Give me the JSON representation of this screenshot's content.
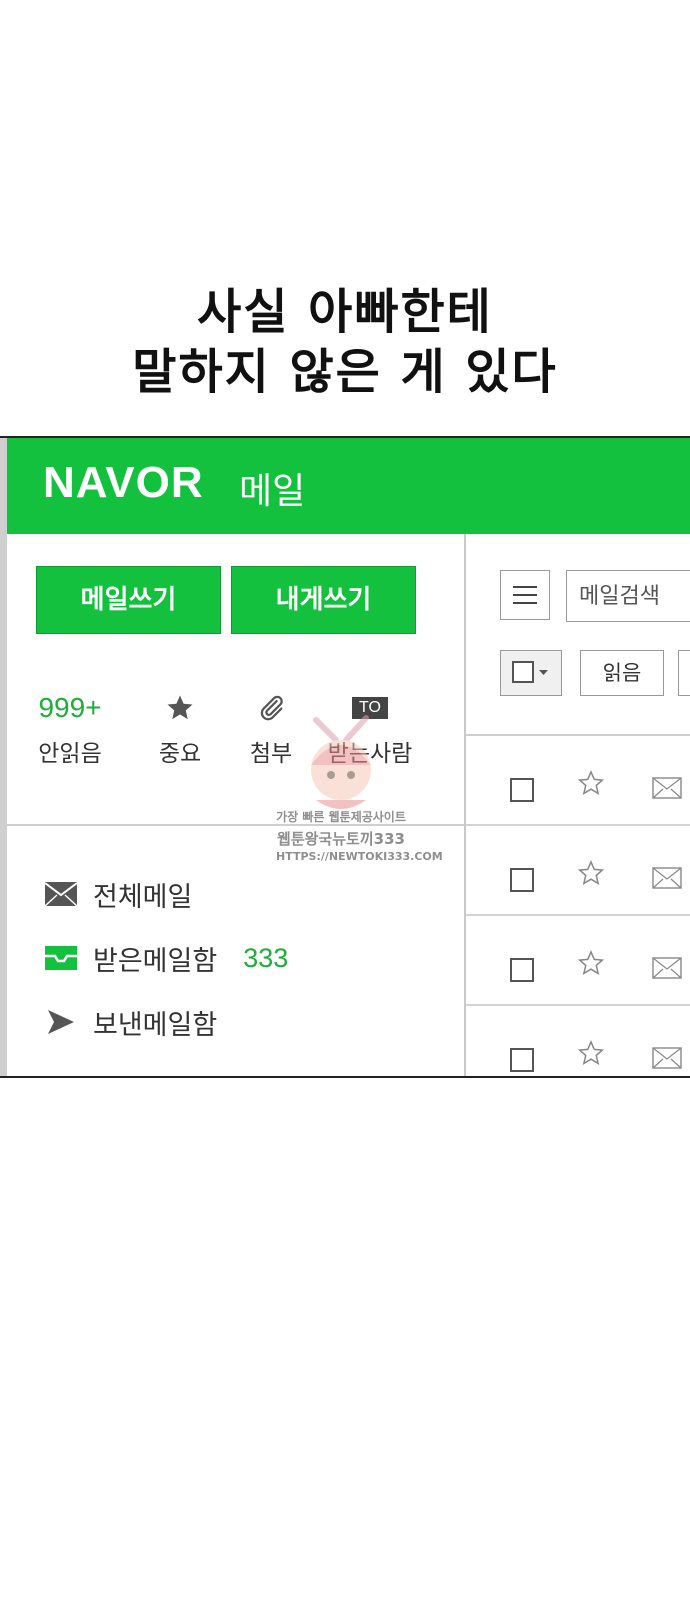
{
  "caption": {
    "line1": "사실 아빠한테",
    "line2": "말하지 않은 게 있다"
  },
  "app": {
    "brand": "NAVOR",
    "brand_sub": "메일",
    "brand_color": "#14c13f",
    "accent_count_color": "#1fad3a"
  },
  "sidebar": {
    "compose_button": "메일쓰기",
    "self_button": "내게쓰기",
    "quick_filters": [
      {
        "top": "999+",
        "label": "안읽음",
        "icon": "count"
      },
      {
        "top": "",
        "label": "중요",
        "icon": "star-icon"
      },
      {
        "top": "",
        "label": "첨부",
        "icon": "paperclip-icon"
      },
      {
        "top": "TO",
        "label": "받는사람",
        "icon": "to-badge"
      }
    ],
    "folders": [
      {
        "name": "전체메일",
        "icon": "envelope-icon",
        "count": ""
      },
      {
        "name": "받은메일함",
        "icon": "inbox-icon",
        "count": "333"
      },
      {
        "name": "보낸메일함",
        "icon": "paper-plane-icon",
        "count": ""
      }
    ]
  },
  "toolbar": {
    "menu_icon": "hamburger-icon",
    "search_placeholder": "메일검색",
    "read_button": "읽음"
  },
  "watermark": {
    "line1": "가장 빠른 웹툰제공사이트",
    "line2": "웹툰왕국뉴토끼333",
    "line3": "HTTPS://NEWTOKI333.COM"
  }
}
